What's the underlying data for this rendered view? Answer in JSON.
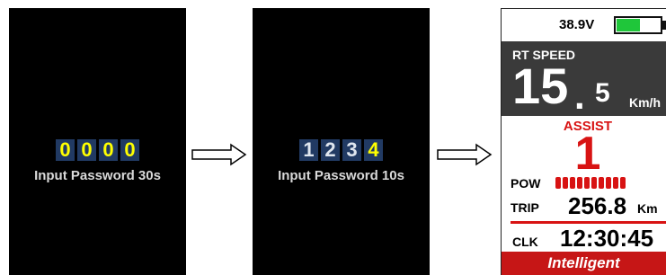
{
  "screen1": {
    "digits": [
      "0",
      "0",
      "0",
      "0"
    ],
    "label": "Input Password 30s"
  },
  "screen2": {
    "digits": [
      "1",
      "2",
      "3",
      "4"
    ],
    "label": "Input Password 10s"
  },
  "display": {
    "voltage": "38.9V",
    "battery_level": 0.55,
    "speed_label": "RT SPEED",
    "speed_int": "15",
    "speed_dot": ".",
    "speed_dec": "5",
    "speed_unit": "Km/h",
    "assist_label": "ASSIST",
    "assist_level": "1",
    "pow_label": "POW",
    "pow_bar_count": 10,
    "trip_label": "TRIP",
    "trip_value": "256.8",
    "trip_unit": "Km",
    "clk_label": "CLK",
    "clk_value": "12:30:45",
    "mode": "Intelligent"
  },
  "colors": {
    "accent_red": "#d81313",
    "battery_green": "#1fc63a",
    "digit_bg": "#213a63",
    "digit_yellow": "#ffff00"
  }
}
